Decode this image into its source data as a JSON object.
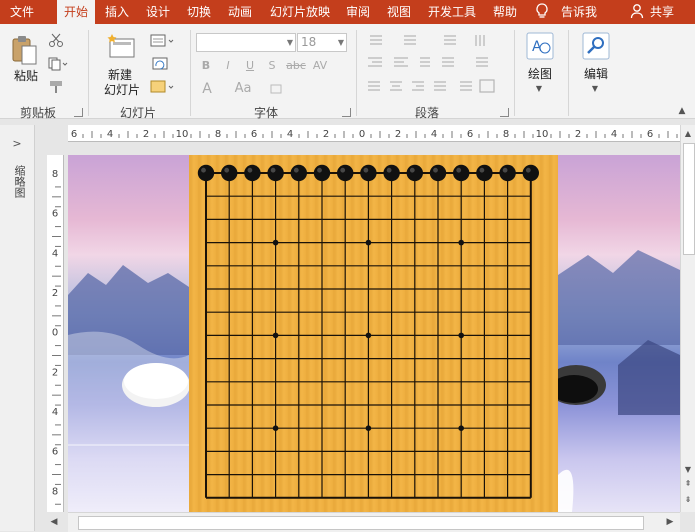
{
  "tabs": [
    {
      "label": "文件",
      "active": false
    },
    {
      "label": "开始",
      "active": true
    },
    {
      "label": "插入",
      "active": false
    },
    {
      "label": "设计",
      "active": false
    },
    {
      "label": "切换",
      "active": false
    },
    {
      "label": "动画",
      "active": false
    },
    {
      "label": "幻灯片放映",
      "active": false
    },
    {
      "label": "审阅",
      "active": false
    },
    {
      "label": "视图",
      "active": false
    },
    {
      "label": "开发工具",
      "active": false
    },
    {
      "label": "帮助",
      "active": false
    }
  ],
  "tell_me": "告诉我",
  "share": "共享",
  "clipboard": {
    "paste": "粘贴",
    "group": "剪贴板"
  },
  "slides": {
    "new_slide_line1": "新建",
    "new_slide_line2": "幻灯片",
    "group": "幻灯片"
  },
  "font": {
    "size": "18",
    "group": "字体",
    "bold": "B",
    "italic": "I",
    "underline": "U",
    "strike": "S",
    "shadow": "abc",
    "spacing": "AV",
    "color": "A",
    "case": "Aa"
  },
  "paragraph": {
    "group": "段落"
  },
  "drawing": {
    "label": "绘图"
  },
  "editing": {
    "label": "编辑"
  },
  "left_pane": {
    "label": "缩略图"
  },
  "ruler_labels": [
    "6",
    "4",
    "2",
    "10",
    "8",
    "6",
    "4",
    "2",
    "0",
    "2",
    "4",
    "6",
    "8",
    "10",
    "2",
    "4",
    "6"
  ],
  "vruler_labels": [
    "8",
    "6",
    "4",
    "2",
    "0",
    "2",
    "4",
    "6",
    "8"
  ],
  "board": {
    "lines": 15,
    "top_stones": 15,
    "star_points": 9
  },
  "colors": {
    "accent": "#c43e1c",
    "board": "#f2b241",
    "stone": "#111111"
  }
}
